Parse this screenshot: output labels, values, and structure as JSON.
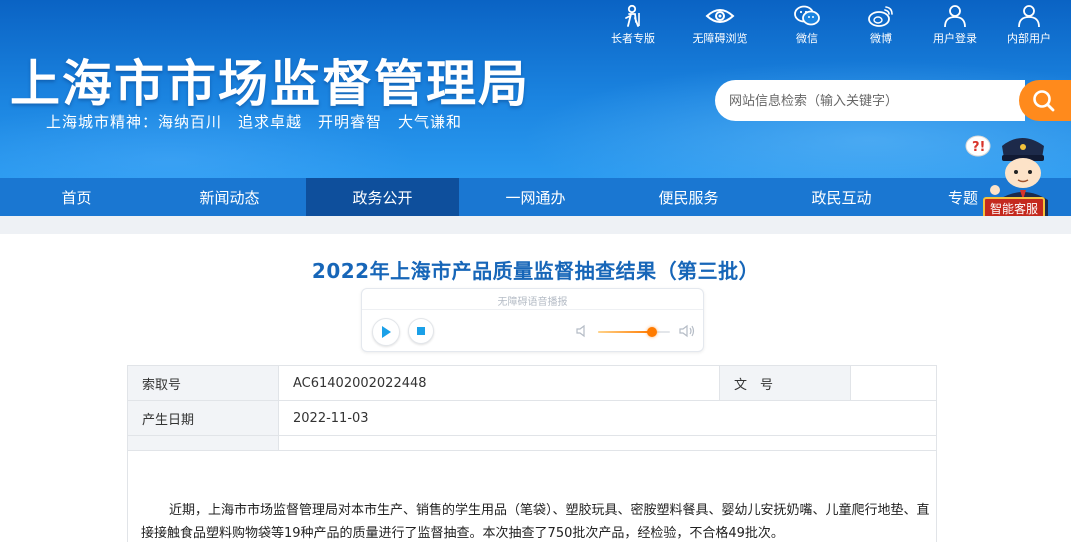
{
  "header": {
    "title": "上海市市场监督管理局",
    "slogan": "上海城市精神：海纳百川　追求卓越　开明睿智　大气谦和",
    "top_links": [
      {
        "label": "长者专版",
        "icon": "elder-icon"
      },
      {
        "label": "无障碍浏览",
        "icon": "eye-icon"
      },
      {
        "label": "微信",
        "icon": "wechat-icon"
      },
      {
        "label": "微博",
        "icon": "weibo-icon"
      },
      {
        "label": "用户登录",
        "icon": "user-icon"
      },
      {
        "label": "内部用户",
        "icon": "user-icon"
      }
    ],
    "search": {
      "placeholder": "网站信息检索（输入关键字）",
      "icon": "search-icon"
    }
  },
  "nav": {
    "items": [
      {
        "label": "首页"
      },
      {
        "label": "新闻动态"
      },
      {
        "label": "政务公开",
        "active": true
      },
      {
        "label": "一网通办"
      },
      {
        "label": "便民服务"
      },
      {
        "label": "政民互动"
      },
      {
        "label": "专题"
      }
    ]
  },
  "mascot": {
    "label": "智能客服"
  },
  "article": {
    "title": "2022年上海市产品质量监督抽查结果（第三批）",
    "audio": {
      "label": "无障碍语音播报",
      "volume_fraction": 0.75
    },
    "meta": {
      "index_key": "索取号",
      "index_value": "AC61402002022448",
      "doc_key": "文　号",
      "doc_value": "",
      "date_key": "产生日期",
      "date_value": "2022-11-03"
    },
    "paragraph": "近期，上海市市场监督管理局对本市生产、销售的学生用品（笔袋）、塑胶玩具、密胺塑料餐具、婴幼儿安抚奶嘴、儿童爬行地垫、直接接触食品塑料购物袋等19种产品的质量进行了监督抽查。本次抽查了750批次产品，经检验，不合格49批次。"
  },
  "colors": {
    "header_blue": "#1b84e0",
    "nav_blue": "#1a77d2",
    "nav_active": "#0e4f9c",
    "title_blue": "#1766b8",
    "search_orange": "#ff8a1c"
  }
}
